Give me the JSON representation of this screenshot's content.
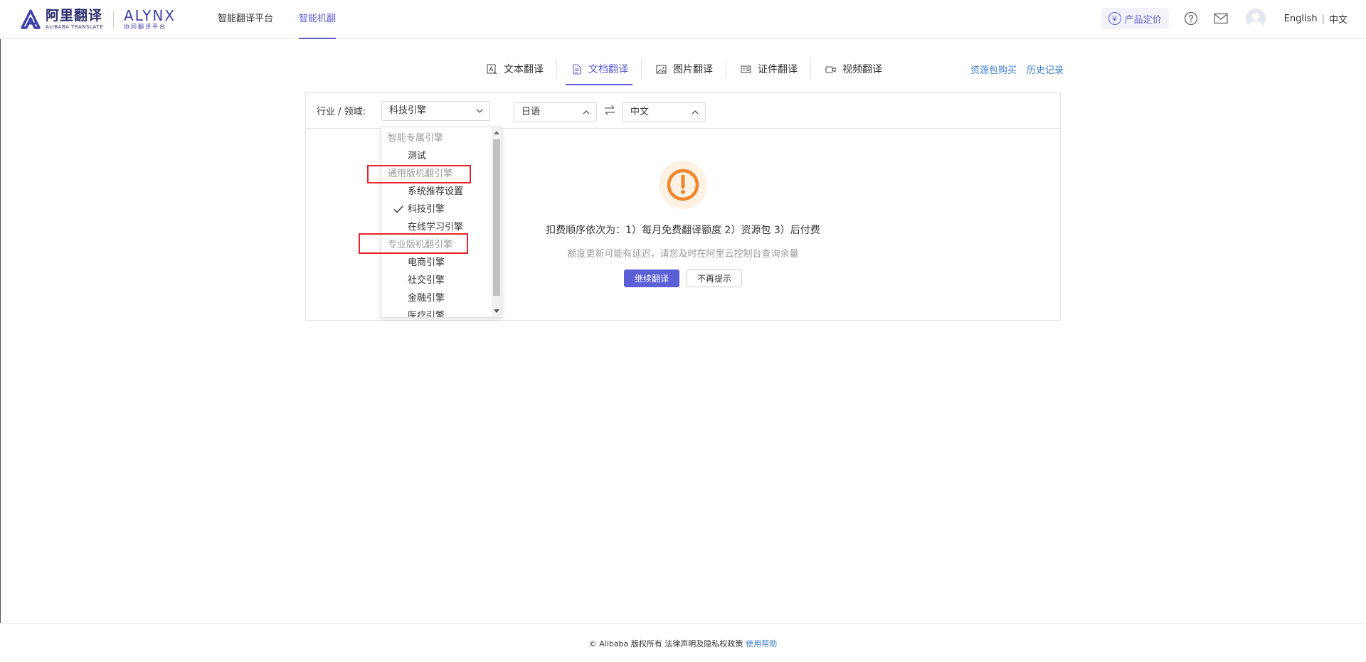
{
  "brand": {
    "logo_cn": "阿里翻译",
    "logo_en": "ALIBABA TRANSLATE",
    "alynx_title": "ALYNX",
    "alynx_sub": "协同翻译平台"
  },
  "top_nav": [
    {
      "label": "智能翻译平台",
      "active": false
    },
    {
      "label": "智能机翻",
      "active": true
    }
  ],
  "header_right": {
    "pricing_label": "产品定价",
    "pricing_icon": "yen-icon",
    "yen_glyph": "¥",
    "help_icon": "help-icon",
    "mail_icon": "mail-icon",
    "lang_english": "English",
    "lang_sep": "|",
    "lang_chinese": "中文"
  },
  "tabs": [
    {
      "label": "文本翻译",
      "icon": "text-translate-icon",
      "active": false
    },
    {
      "label": "文档翻译",
      "icon": "document-icon",
      "active": true
    },
    {
      "label": "图片翻译",
      "icon": "image-icon",
      "active": false
    },
    {
      "label": "证件翻译",
      "icon": "id-card-icon",
      "active": false
    },
    {
      "label": "视频翻译",
      "icon": "video-icon",
      "active": false
    }
  ],
  "tab_links": {
    "purchase": "资源包购买",
    "history": "历史记录"
  },
  "toolbar": {
    "domain_label": "行业 / 领域:",
    "domain_value": "科技引擎",
    "source_lang": "日语",
    "target_lang": "中文"
  },
  "dropdown": {
    "items": [
      {
        "type": "group",
        "label": "智能专属引擎"
      },
      {
        "type": "option",
        "label": "测试",
        "selected": false
      },
      {
        "type": "group",
        "label": "通用版机翻引擎"
      },
      {
        "type": "option",
        "label": "系统推荐设置",
        "selected": false
      },
      {
        "type": "option",
        "label": "科技引擎",
        "selected": true
      },
      {
        "type": "option",
        "label": "在线学习引擎",
        "selected": false
      },
      {
        "type": "group",
        "label": "专业版机翻引擎"
      },
      {
        "type": "option",
        "label": "电商引擎",
        "selected": false
      },
      {
        "type": "option",
        "label": "社交引擎",
        "selected": false
      },
      {
        "type": "option",
        "label": "金融引擎",
        "selected": false
      },
      {
        "type": "option",
        "label": "医疗引擎",
        "selected": false
      }
    ]
  },
  "notice": {
    "main": "扣费顺序依次为：1）每月免费翻译额度 2）资源包 3）后付费",
    "sub": "额度更新可能有延迟，请您及时在阿里云控制台查询余量",
    "primary_button": "继续翻译",
    "secondary_button": "不再提示"
  },
  "footer": {
    "copyright": "© Alibaba 版权所有 法律声明及隐私权政策",
    "help_link": "使用帮助"
  },
  "colors": {
    "accent": "#5a5fd6",
    "link": "#3d7fd6",
    "warning": "#f0862a",
    "highlight_box": "#e8232b"
  }
}
